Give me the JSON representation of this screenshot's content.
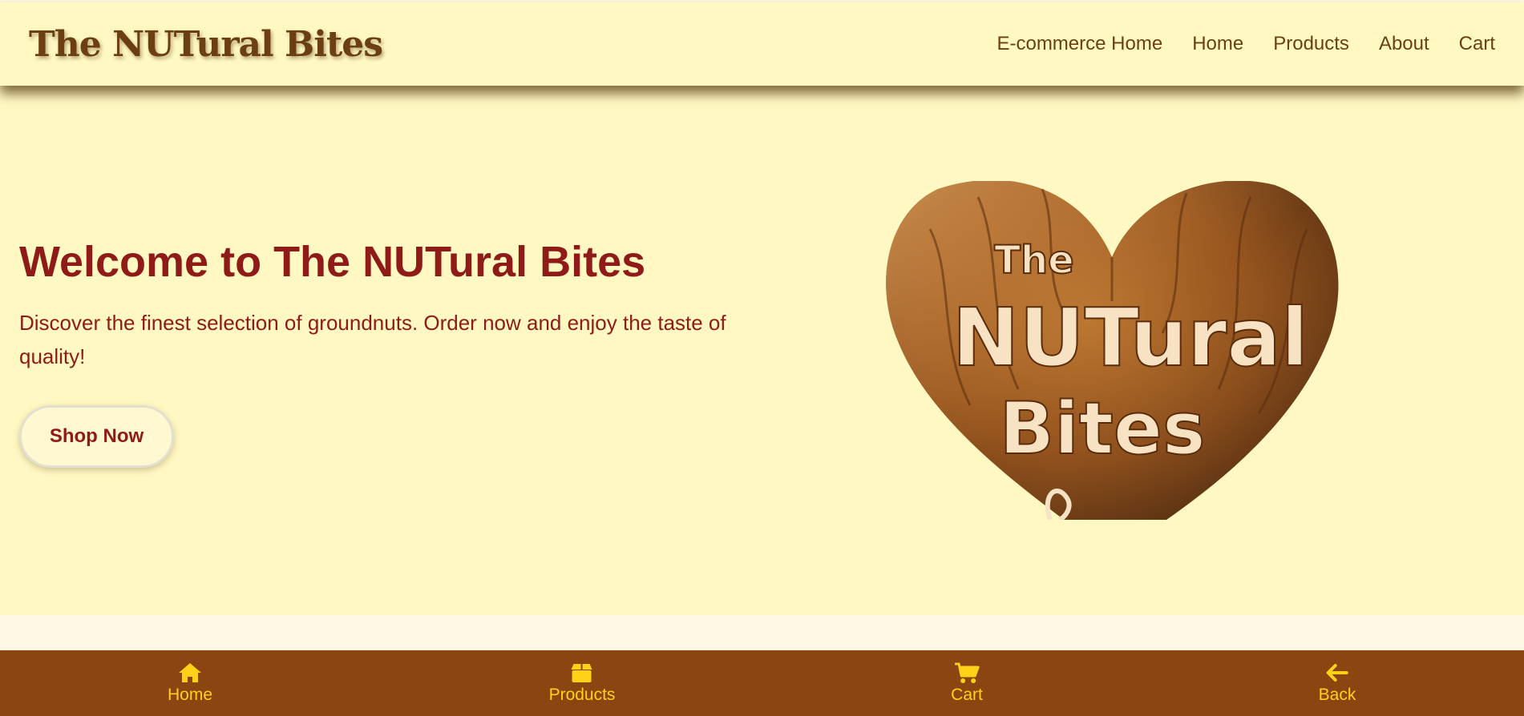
{
  "header": {
    "brand": "The NUTural Bites",
    "nav": [
      {
        "label": "E-commerce Home"
      },
      {
        "label": "Home"
      },
      {
        "label": "Products"
      },
      {
        "label": "About"
      },
      {
        "label": "Cart"
      }
    ]
  },
  "hero": {
    "title": "Welcome to The NUTural Bites",
    "description": "Discover the finest selection of groundnuts. Order now and enjoy the taste of quality!",
    "cta_label": "Shop Now",
    "logo": {
      "line1": "The",
      "line2": "NUTural",
      "line3": "Bites"
    }
  },
  "bottom_nav": [
    {
      "label": "Home",
      "icon": "home-icon"
    },
    {
      "label": "Products",
      "icon": "box-icon"
    },
    {
      "label": "Cart",
      "icon": "cart-icon"
    },
    {
      "label": "Back",
      "icon": "arrow-left-icon"
    }
  ],
  "colors": {
    "header_bg": "#fff8c2",
    "brand_text": "#6b3f12",
    "hero_text": "#8e1b18",
    "bottom_nav_bg": "#8a4511",
    "bottom_nav_accent": "#ffd21a"
  }
}
